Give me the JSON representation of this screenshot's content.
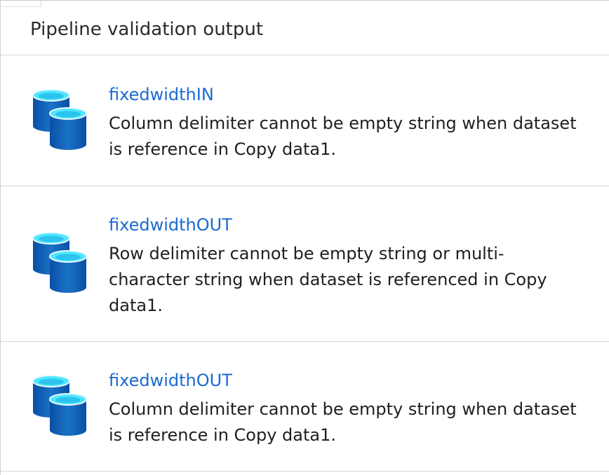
{
  "panel": {
    "title": "Pipeline validation output"
  },
  "items": [
    {
      "icon": "database-icon",
      "dataset": "fixedwidthIN",
      "message": "Column delimiter cannot be empty string when dataset\nis reference in Copy data1."
    },
    {
      "icon": "database-icon",
      "dataset": "fixedwidthOUT",
      "message": "Row delimiter cannot be empty string or multi-\ncharacter string when dataset is referenced in Copy\ndata1."
    },
    {
      "icon": "database-icon",
      "dataset": "fixedwidthOUT",
      "message": "Column delimiter cannot be empty string when dataset\nis reference in Copy data1."
    }
  ],
  "colors": {
    "link": "#1b6ad0",
    "icon_dark": "#0a4fa3",
    "icon_mid": "#1a73c9",
    "icon_top": "#50e6ff",
    "divider": "#d6d6d6"
  }
}
